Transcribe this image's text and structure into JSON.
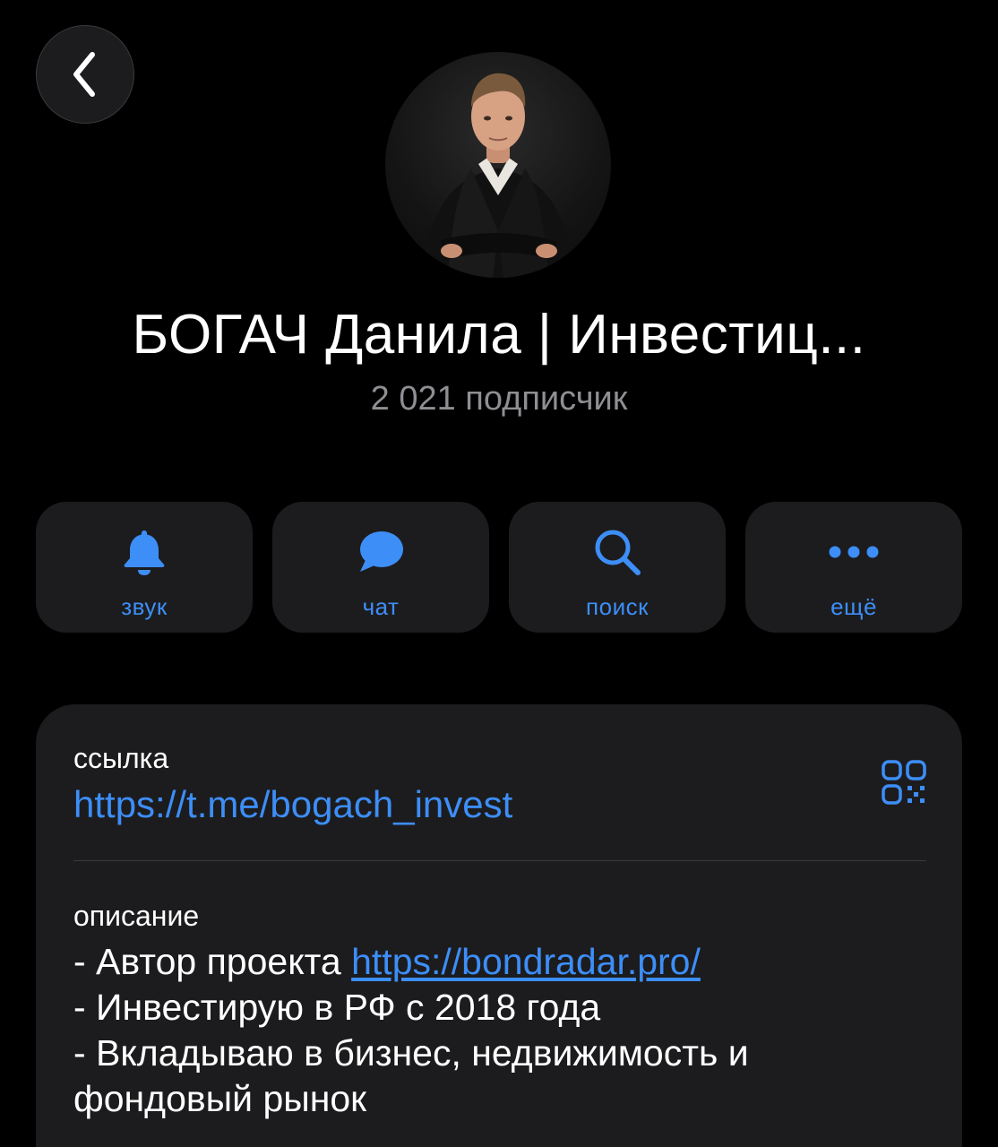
{
  "header": {
    "back_icon": "chevron-left-icon"
  },
  "profile": {
    "title": "БОГАЧ Данила | Инвестиц...",
    "subscribers": "2 021 подписчик"
  },
  "actions": [
    {
      "label": "звук",
      "icon": "bell-icon"
    },
    {
      "label": "чат",
      "icon": "chat-bubble-icon"
    },
    {
      "label": "поиск",
      "icon": "search-icon"
    },
    {
      "label": "ещё",
      "icon": "more-dots-icon"
    }
  ],
  "info": {
    "link_label": "ссылка",
    "link_value": "https://t.me/bogach_invest",
    "description_label": "описание",
    "description": {
      "line1_prefix": "- Автор проекта ",
      "line1_link": "https://bondradar.pro/",
      "line2": "- Инвестирую в РФ с 2018 года",
      "line3": "- Вкладываю в бизнес, недвижимость и",
      "line4": "фондовый рынок"
    }
  },
  "colors": {
    "background": "#000000",
    "card": "#1c1c1e",
    "accent": "#3d8ef7",
    "secondary_text": "#8e8e93"
  }
}
